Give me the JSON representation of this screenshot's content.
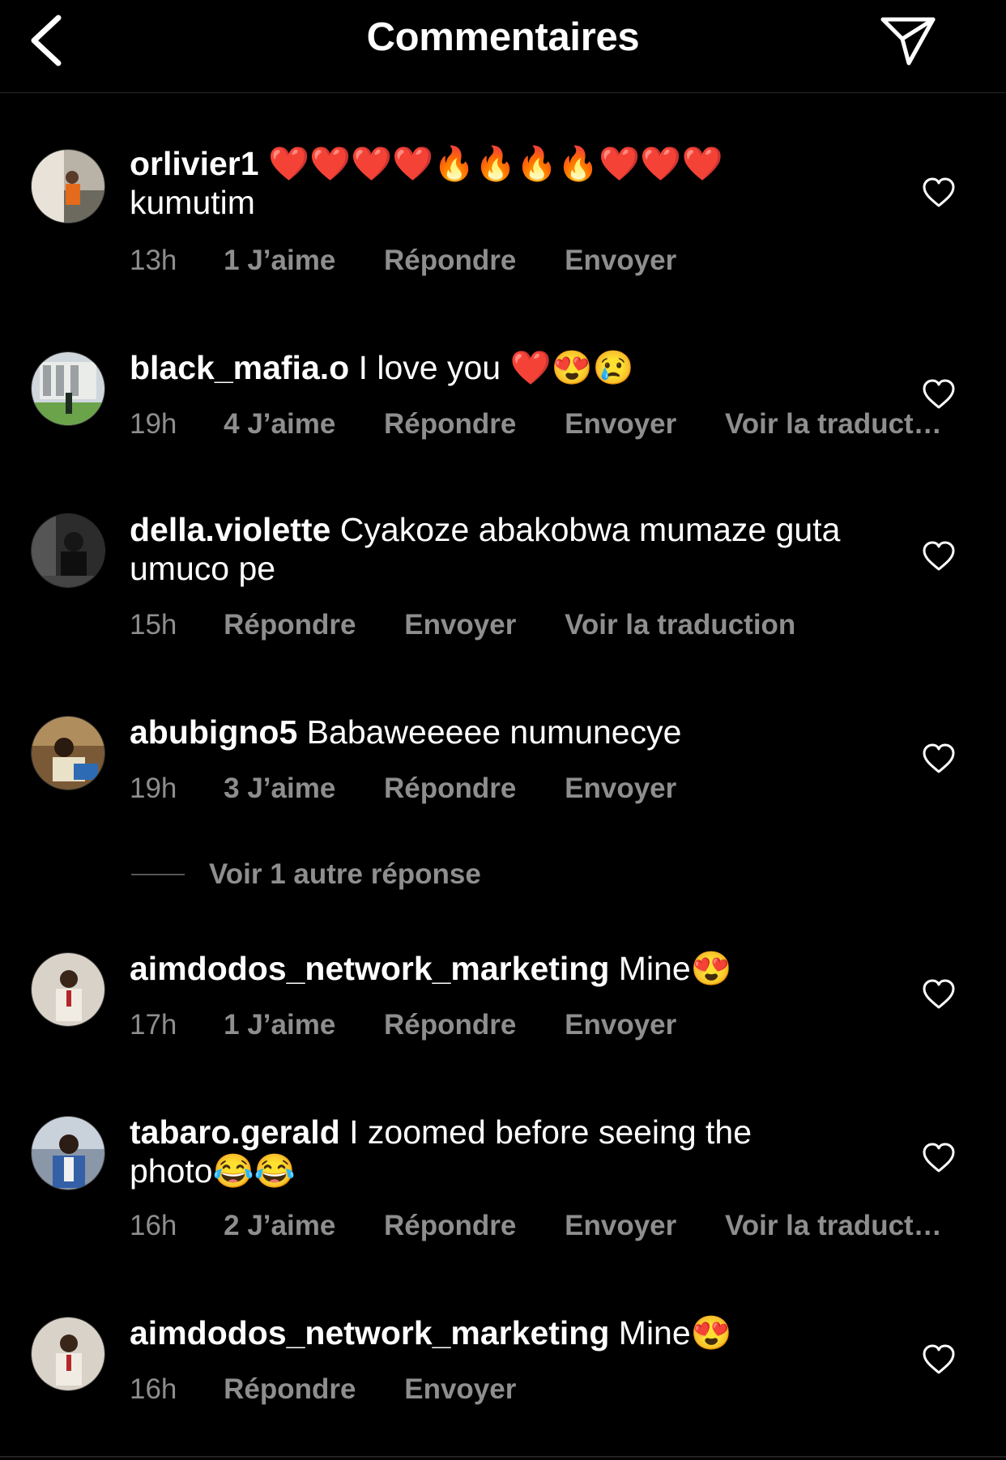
{
  "header": {
    "title": "Commentaires",
    "back_icon": "chevron-left-icon",
    "send_icon": "paper-plane-icon"
  },
  "comments": [
    {
      "username": "orlivier1",
      "text": "❤️❤️❤️❤️🔥🔥🔥🔥❤️❤️❤️ kumutim",
      "time": "13h",
      "likes": "1 J’aime",
      "reply": "Répondre",
      "send": "Envoyer",
      "translate": ""
    },
    {
      "username": "black_mafia.o",
      "text": "I love you ❤️😍😢",
      "time": "19h",
      "likes": "4 J’aime",
      "reply": "Répondre",
      "send": "Envoyer",
      "translate": "Voir la traduct…"
    },
    {
      "username": "della.violette",
      "text": "Cyakoze abakobwa mumaze guta umuco pe",
      "time": "15h",
      "likes": "",
      "reply": "Répondre",
      "send": "Envoyer",
      "translate": "Voir la traduction"
    },
    {
      "username": "abubigno5",
      "text": "Babaweeeee numunecye",
      "time": "19h",
      "likes": "3 J’aime",
      "reply": "Répondre",
      "send": "Envoyer",
      "translate": ""
    },
    {
      "username": "aimdodos_network_marketing",
      "text": "Mine😍",
      "time": "17h",
      "likes": "1 J’aime",
      "reply": "Répondre",
      "send": "Envoyer",
      "translate": ""
    },
    {
      "username": "tabaro.gerald",
      "text": "I zoomed before seeing the photo😂😂",
      "time": "16h",
      "likes": "2 J’aime",
      "reply": "Répondre",
      "send": "Envoyer",
      "translate": "Voir la traduct…"
    },
    {
      "username": "aimdodos_network_marketing",
      "text": "Mine😍",
      "time": "16h",
      "likes": "",
      "reply": "Répondre",
      "send": "Envoyer",
      "translate": ""
    }
  ],
  "view_replies": "Voir 1 autre réponse",
  "icons": {
    "like": "heart-outline-icon"
  },
  "colors": {
    "background": "#000000",
    "text": "#ffffff",
    "secondary": "#8e8e8e"
  }
}
